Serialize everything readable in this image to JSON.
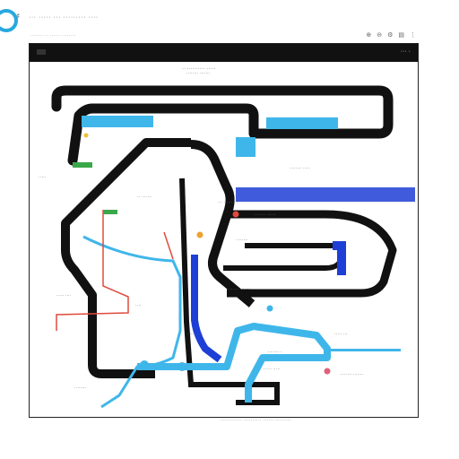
{
  "app": {
    "title": "··· ····· ··· ········· ····",
    "subtitle": "······· ·· ····· · ·······",
    "menu_glyph": "♯"
  },
  "toolbar": {
    "buttons": [
      {
        "name": "zoom-in-icon",
        "glyph": "⊕"
      },
      {
        "name": "zoom-out-icon",
        "glyph": "⊖"
      },
      {
        "name": "settings-icon",
        "glyph": "⚙"
      },
      {
        "name": "layers-icon",
        "glyph": "▤"
      },
      {
        "name": "more-icon",
        "glyph": "⋮"
      }
    ]
  },
  "map": {
    "header_label": "··· ·",
    "title": "·· ·········· ·····",
    "footer": "············ ·········· ······ ·········",
    "labels": [
      "········ ·······",
      "········ ·····",
      "·· ·······",
      "··· ········ ·",
      "········",
      "········ ·······",
      "····· ····",
      "····",
      "······ ···",
      "········ ·",
      "····· ···",
      "········",
      "······ ·····",
      "········ ·······",
      "·····",
      "········ ······"
    ]
  },
  "colors": {
    "line_black": "#111111",
    "line_cyan": "#3fb6ea",
    "line_blue": "#1e3fd6",
    "line_red": "#e04a3c",
    "accent_green": "#3aa84a",
    "accent_yellow": "#f0c030"
  }
}
